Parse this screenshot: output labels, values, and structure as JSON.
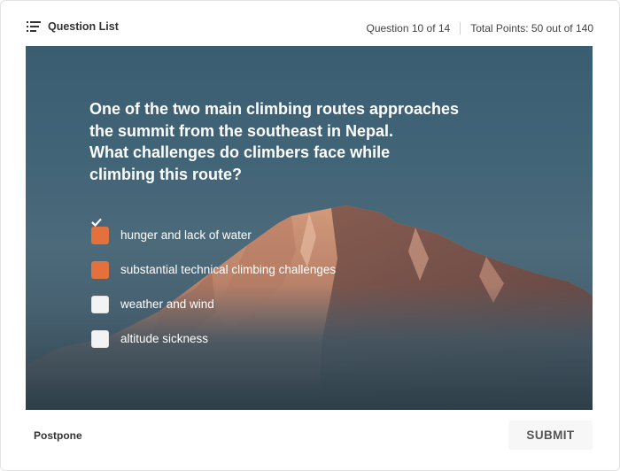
{
  "header": {
    "question_list_label": "Question List",
    "question_counter": "Question 10 of 14",
    "total_points": "Total Points: 50 out of 140"
  },
  "question": {
    "text": "One of the two main climbing routes approaches\nthe summit from the southeast in Nepal.\nWhat challenges do climbers face while\nclimbing this route?",
    "options": [
      {
        "label": "hunger and lack of water",
        "checked": true
      },
      {
        "label": "substantial technical climbing challenges",
        "checked": true
      },
      {
        "label": "weather and wind",
        "checked": false
      },
      {
        "label": "altitude sickness",
        "checked": false
      }
    ]
  },
  "footer": {
    "postpone_label": "Postpone",
    "submit_label": "SUBMIT"
  },
  "colors": {
    "accent": "#e4713c",
    "sky": "#3b5d72",
    "mountain_lit": "#c98a6c",
    "mountain_shadow": "#6b4a44"
  },
  "icons": {
    "question_list": "list-icon",
    "check": "checkmark-icon"
  }
}
